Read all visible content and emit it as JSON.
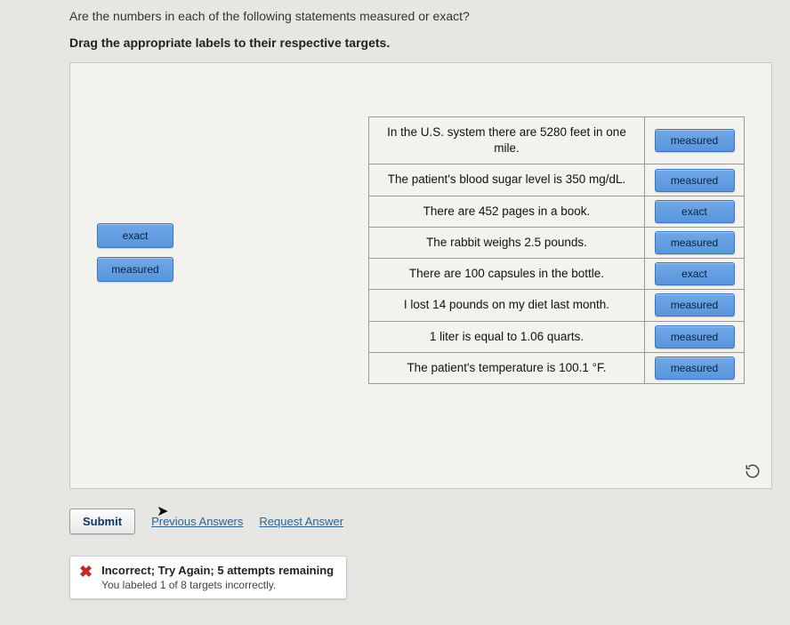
{
  "question": "Are the numbers in each of the following statements measured or exact?",
  "instruction": "Drag the appropriate labels to their respective targets.",
  "source_labels": {
    "exact": "exact",
    "measured": "measured"
  },
  "statements": [
    {
      "text": "In the U.S. system there are 5280 feet in one mile.",
      "placed": "measured"
    },
    {
      "text": "The patient's blood sugar level is 350 mg/dL.",
      "placed": "measured"
    },
    {
      "text": "There are 452 pages in a book.",
      "placed": "exact"
    },
    {
      "text": "The rabbit weighs 2.5 pounds.",
      "placed": "measured"
    },
    {
      "text": "There are 100 capsules in the bottle.",
      "placed": "exact"
    },
    {
      "text": "I lost 14 pounds on my diet last month.",
      "placed": "measured"
    },
    {
      "text": "1 liter is equal to 1.06 quarts.",
      "placed": "measured"
    },
    {
      "text": "The patient's temperature is 100.1 °F.",
      "placed": "measured"
    }
  ],
  "buttons": {
    "submit": "Submit",
    "previous": "Previous Answers",
    "request": "Request Answer"
  },
  "feedback": {
    "title": "Incorrect; Try Again; 5 attempts remaining",
    "sub": "You labeled 1 of 8 targets incorrectly."
  }
}
